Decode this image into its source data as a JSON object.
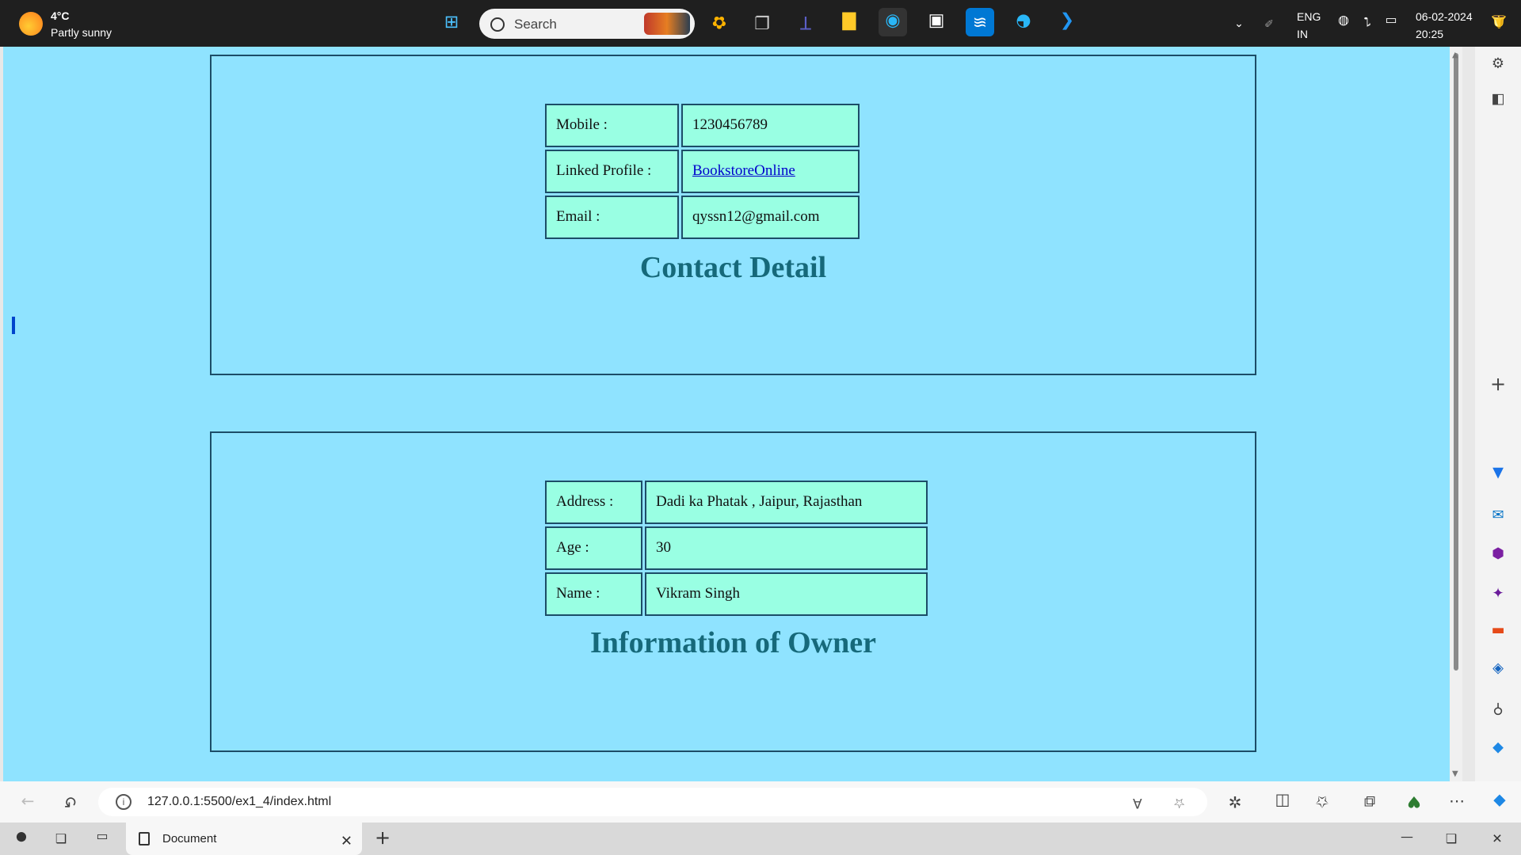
{
  "browser": {
    "tab_title": "Document",
    "url": "127.0.0.1:5500/ex1_4/index.html"
  },
  "page": {
    "contact": {
      "title": "Contact Detail",
      "rows": [
        {
          "label": "Mobile :",
          "value": "1230456789"
        },
        {
          "label": "Linked Profile :",
          "value": "BookstoreOnline"
        },
        {
          "label": "Email :",
          "value": "qyssn12@gmail.com"
        }
      ]
    },
    "owner": {
      "title": "Information of Owner",
      "rows": [
        {
          "label": "Address :",
          "value": "Dadi ka Phatak , Jaipur, Rajasthan"
        },
        {
          "label": "Age :",
          "value": "30"
        },
        {
          "label": "Name :",
          "value": "Vikram Singh"
        }
      ]
    }
  },
  "taskbar": {
    "weather_temp": "4°C",
    "weather_desc": "Partly sunny",
    "search_placeholder": "Search",
    "lang_line1": "IN",
    "lang_line2": "ENG",
    "time": "20:25",
    "date": "06-02-2024"
  },
  "colors": {
    "page_bg": "#8fe3ff",
    "cell_bg": "#99ffe3",
    "title_color": "#16697a",
    "border": "#1c4d67"
  }
}
